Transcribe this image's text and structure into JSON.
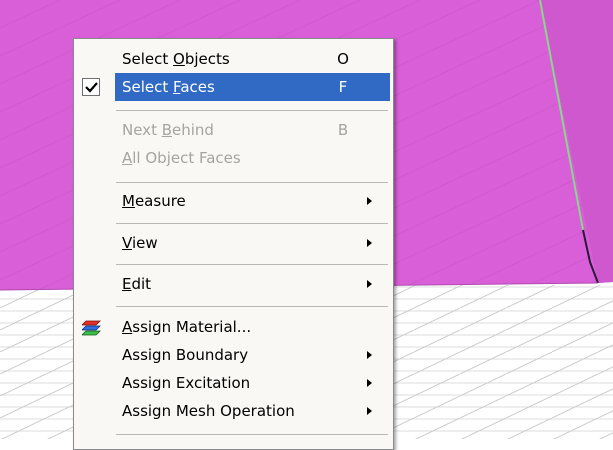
{
  "scene": {
    "colors": {
      "surface_top": "#d85fd8",
      "surface_edge": "#c557c5",
      "ground": "#ffffff",
      "grid_line": "#c9c9c9",
      "green_edge": "#8ad68a",
      "dark_edge": "#2a1a3a"
    }
  },
  "context_menu": {
    "items": [
      {
        "pre": "Select ",
        "key": "O",
        "post": "bjects",
        "shortcut": "O",
        "checked": false,
        "disabled": false,
        "submenu": false
      },
      {
        "pre": "Select ",
        "key": "F",
        "post": "aces",
        "shortcut": "F",
        "checked": true,
        "disabled": false,
        "submenu": false,
        "highlighted": true
      },
      {
        "pre": "Next ",
        "key": "B",
        "post": "ehind",
        "shortcut": "B",
        "checked": false,
        "disabled": true,
        "submenu": false
      },
      {
        "pre": "",
        "key": "A",
        "post": "ll Object Faces",
        "shortcut": "",
        "checked": false,
        "disabled": true,
        "submenu": false
      },
      {
        "pre": "",
        "key": "M",
        "post": "easure",
        "shortcut": "",
        "checked": false,
        "disabled": false,
        "submenu": true
      },
      {
        "pre": "",
        "key": "V",
        "post": "iew",
        "shortcut": "",
        "checked": false,
        "disabled": false,
        "submenu": true
      },
      {
        "pre": "",
        "key": "E",
        "post": "dit",
        "shortcut": "",
        "checked": false,
        "disabled": false,
        "submenu": true
      },
      {
        "pre": "",
        "key": "A",
        "post": "ssign Material...",
        "shortcut": "",
        "checked": false,
        "disabled": false,
        "submenu": false,
        "icon": "assign-material-icon"
      },
      {
        "pre": "Assign Boundary",
        "key": "",
        "post": "",
        "shortcut": "",
        "checked": false,
        "disabled": false,
        "submenu": true
      },
      {
        "pre": "Assign Excitation",
        "key": "",
        "post": "",
        "shortcut": "",
        "checked": false,
        "disabled": false,
        "submenu": true
      },
      {
        "pre": "Assign Mesh Operation",
        "key": "",
        "post": "",
        "shortcut": "",
        "checked": false,
        "disabled": false,
        "submenu": true
      }
    ]
  }
}
